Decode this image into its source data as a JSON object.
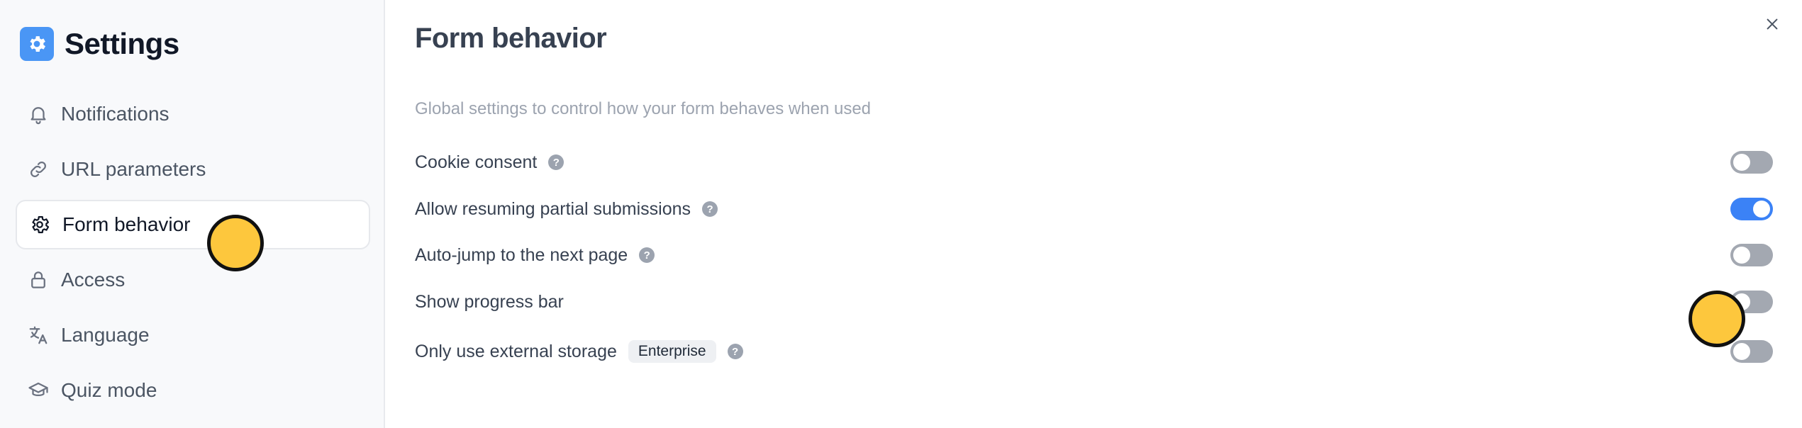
{
  "sidebar": {
    "brand": {
      "title": "Settings",
      "icon": "gear-icon",
      "color": "#4a96f5"
    },
    "items": [
      {
        "label": "Notifications",
        "icon": "bell-icon",
        "active": false
      },
      {
        "label": "URL parameters",
        "icon": "link-icon",
        "active": false
      },
      {
        "label": "Form behavior",
        "icon": "gear-icon",
        "active": true
      },
      {
        "label": "Access",
        "icon": "lock-icon",
        "active": false
      },
      {
        "label": "Language",
        "icon": "translate-icon",
        "active": false
      },
      {
        "label": "Quiz mode",
        "icon": "graduation-cap-icon",
        "active": false
      }
    ]
  },
  "main": {
    "title": "Form behavior",
    "description": "Global settings to control how your form behaves when used",
    "close_icon": "close-icon",
    "options": [
      {
        "label": "Cookie consent",
        "help": "?",
        "enabled": false
      },
      {
        "label": "Allow resuming partial submissions",
        "help": "?",
        "enabled": true
      },
      {
        "label": "Auto-jump to the next page",
        "help": "?",
        "enabled": false
      },
      {
        "label": "Show progress bar",
        "enabled": false
      },
      {
        "label": "Only use external storage",
        "badge": "Enterprise",
        "help": "?",
        "enabled": false
      }
    ]
  },
  "colors": {
    "accent": "#3b82f6",
    "toggle_off": "#a3a8b1",
    "cursor_marker": "#fdc73d"
  }
}
